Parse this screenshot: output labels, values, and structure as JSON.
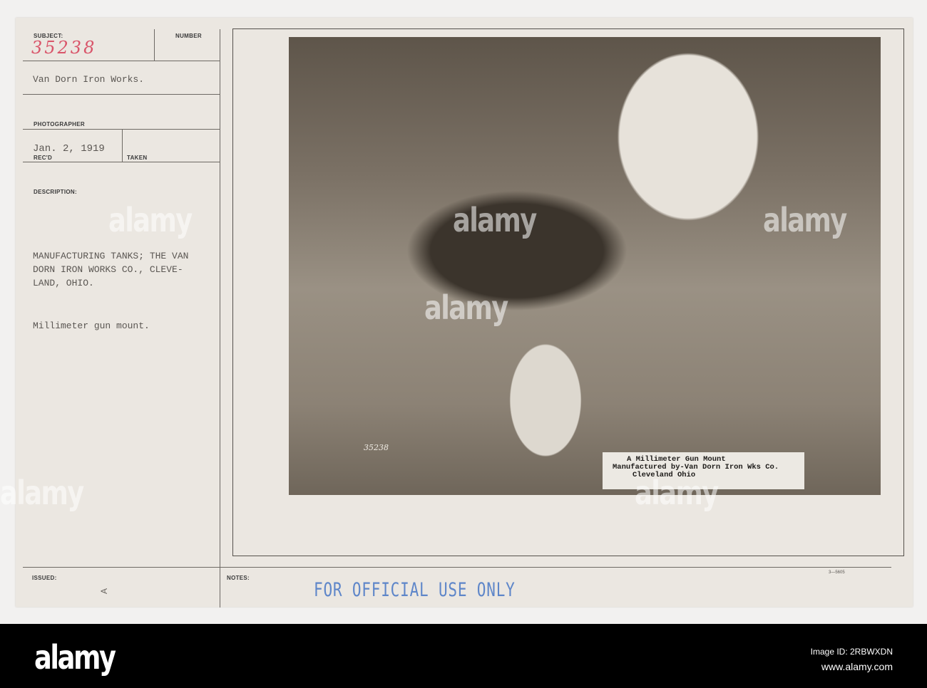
{
  "card": {
    "subject_label": "SUBJECT:",
    "subject_number_handwritten": "35238",
    "number_label": "NUMBER",
    "subject": "Van Dorn Iron Works.",
    "photographer_label": "PHOTOGRAPHER",
    "date": "Jan. 2, 1919",
    "recd_label": "REC'D",
    "taken_label": "TAKEN",
    "description_label": "DESCRIPTION:",
    "description_lines": [
      "MANUFACTURING TANKS; THE VAN",
      "DORN IRON WORKS CO., CLEVE-",
      "LAND, OHIO."
    ],
    "caption": "Millimeter gun mount.",
    "issued_label": "ISSUED:",
    "issued_mark": "A",
    "notes_label": "NOTES:",
    "form_number": "3—5605",
    "stamp": "FOR OFFICIAL USE ONLY"
  },
  "photo": {
    "negative_number": "35238",
    "label_lines": [
      "A Millimeter Gun Mount",
      "Manufactured by-Van Dorn Iron Wks Co.",
      "Cleveland Ohio"
    ]
  },
  "watermark": "alamy",
  "footer": {
    "logo": "alamy",
    "image_id": "Image ID: 2RBWXDN",
    "url": "www.alamy.com"
  },
  "colors": {
    "handwriting": "#d9556a",
    "stamp": "#5e86c9",
    "card": "#ebe7e1"
  }
}
